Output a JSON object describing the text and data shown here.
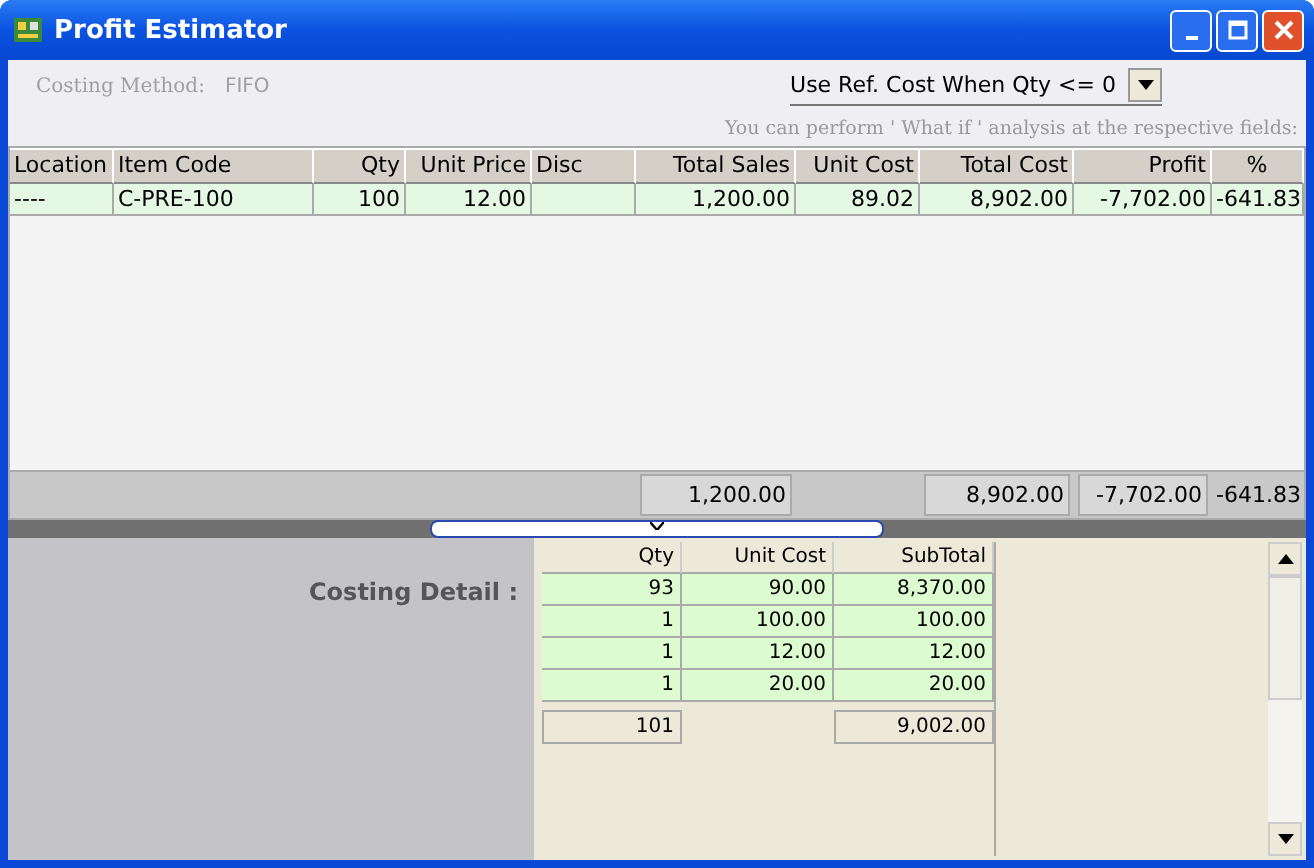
{
  "window": {
    "title": "Profit Estimator"
  },
  "costing_method": {
    "label": "Costing Method:",
    "value": "FIFO"
  },
  "ref_cost_dropdown": {
    "value": "Use Ref. Cost When Qty <= 0"
  },
  "hint": "You can perform ' What if ' analysis at the respective fields:",
  "table": {
    "columns": [
      "Location",
      "Item Code",
      "Qty",
      "Unit Price",
      "Disc",
      "Total Sales",
      "Unit Cost",
      "Total Cost",
      "Profit",
      "%"
    ],
    "rows": [
      {
        "selected": true,
        "cells": [
          "----",
          "C-PRE-100",
          "100",
          "12.00",
          null,
          "1,200.00",
          "89.02",
          "8,902.00",
          "-7,702.00",
          "-641.83"
        ]
      }
    ],
    "totals": {
      "total_sales": "1,200.00",
      "total_cost": "8,902.00",
      "profit": "-7,702.00",
      "percent": "-641.83"
    }
  },
  "costing_detail": {
    "label": "Costing Detail :",
    "columns": [
      "Qty",
      "Unit Cost",
      "SubTotal"
    ],
    "rows": [
      [
        "93",
        "90.00",
        "8,370.00"
      ],
      [
        "1",
        "100.00",
        "100.00"
      ],
      [
        "1",
        "12.00",
        "12.00"
      ],
      [
        "1",
        "20.00",
        "20.00"
      ]
    ],
    "totals": {
      "qty": "101",
      "subtotal": "9,002.00"
    }
  }
}
